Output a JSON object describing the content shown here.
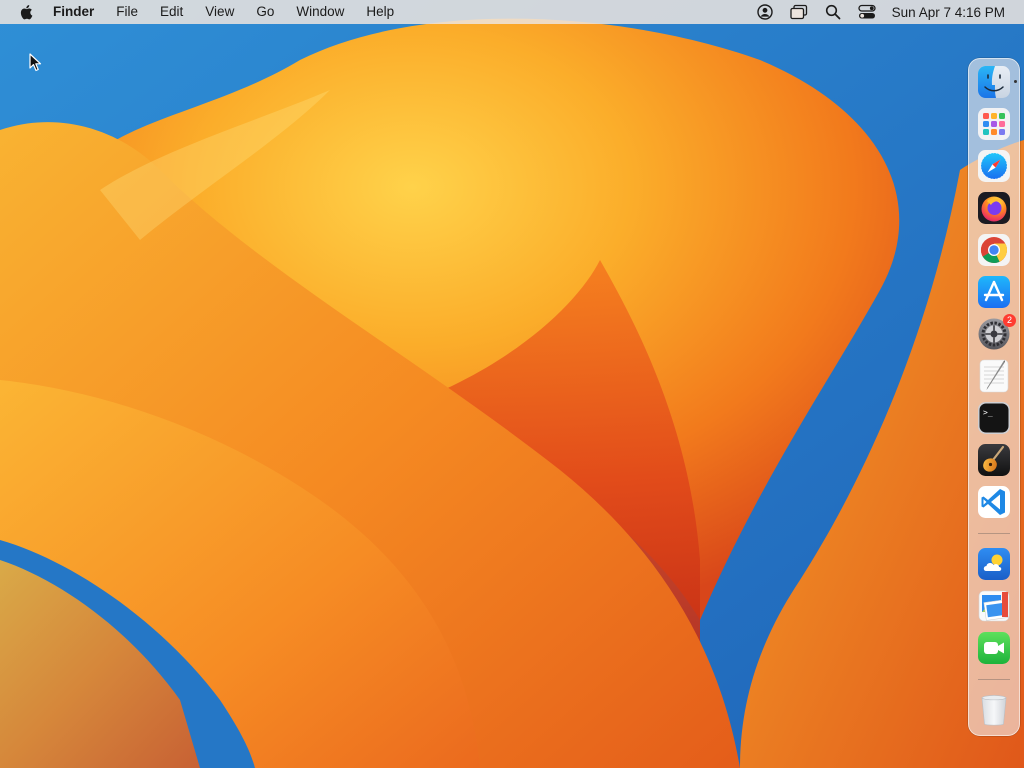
{
  "menubar": {
    "apple_icon": "apple-logo-icon",
    "app_name": "Finder",
    "menus": [
      "File",
      "Edit",
      "View",
      "Go",
      "Window",
      "Help"
    ],
    "status_icons": [
      "user-account-icon",
      "screen-mirroring-icon",
      "spotlight-search-icon",
      "control-center-icon"
    ],
    "clock": "Sun Apr 7  4:16 PM"
  },
  "dock": {
    "apps": [
      {
        "name": "Finder",
        "icon": "finder-icon",
        "running": true
      },
      {
        "name": "Launchpad",
        "icon": "launchpad-icon"
      },
      {
        "name": "Safari",
        "icon": "safari-icon"
      },
      {
        "name": "Firefox",
        "icon": "firefox-icon"
      },
      {
        "name": "Google Chrome",
        "icon": "chrome-icon"
      },
      {
        "name": "App Store",
        "icon": "app-store-icon"
      },
      {
        "name": "System Settings",
        "icon": "system-settings-icon",
        "badge": "2"
      },
      {
        "name": "TextEdit",
        "icon": "textedit-icon"
      },
      {
        "name": "Terminal",
        "icon": "terminal-icon"
      },
      {
        "name": "GarageBand",
        "icon": "garageband-icon"
      },
      {
        "name": "Visual Studio Code",
        "icon": "vscode-icon"
      }
    ],
    "recent": [
      {
        "name": "Weather",
        "icon": "weather-icon"
      },
      {
        "name": "Preview",
        "icon": "preview-icon"
      },
      {
        "name": "FaceTime",
        "icon": "facetime-icon"
      }
    ],
    "trash": {
      "name": "Trash",
      "icon": "trash-icon"
    }
  },
  "colors": {
    "wallpaper_blue": "#2a7ec8",
    "wallpaper_orange": "#f39a1f",
    "wallpaper_red": "#d8461a",
    "badge_red": "#ff3b30"
  }
}
